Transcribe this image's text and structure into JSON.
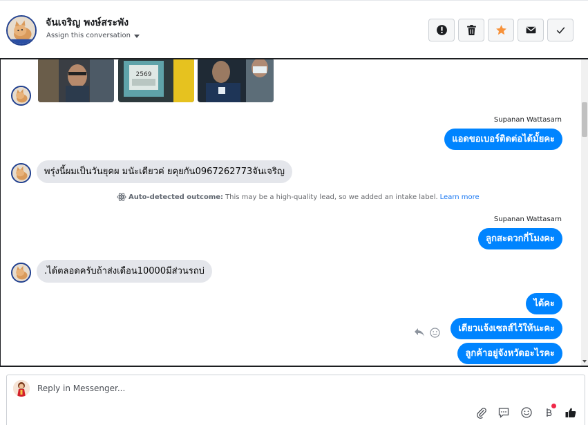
{
  "header": {
    "contact_name": "จันเจริญ พงษ์สระพัง",
    "assign_label": "Assign this conversation",
    "actions": [
      {
        "name": "mark-spam",
        "icon": "exclamation-circle-icon"
      },
      {
        "name": "delete",
        "icon": "trash-icon"
      },
      {
        "name": "star",
        "icon": "star-icon",
        "color": "#f7923b"
      },
      {
        "name": "mark-unread",
        "icon": "envelope-icon"
      },
      {
        "name": "done",
        "icon": "check-icon"
      }
    ]
  },
  "messages": [
    {
      "id": "m1",
      "direction": "in",
      "type": "photos",
      "count": 3
    },
    {
      "id": "m2",
      "direction": "out",
      "sender": "Supanan Wattasarn",
      "text": "แอดขอเบอร์ติดต่อได้มั้ยคะ"
    },
    {
      "id": "m3",
      "direction": "in",
      "text": "พรุ่งนี้ผมเป็นวันยุคผ มนัะเดียวค่ ยคุยกัน0967262773จันเจริญ"
    },
    {
      "id": "m4",
      "direction": "system",
      "icon": "atom-icon",
      "bold": "Auto-detected outcome:",
      "text": "This may be a high-quality lead, so we added an intake label.",
      "link": "Learn more"
    },
    {
      "id": "m5",
      "direction": "out",
      "sender": "Supanan Wattasarn",
      "text": "ลูกสะดวกกี่โมงคะ"
    },
    {
      "id": "m6",
      "direction": "in",
      "text": ".ได้ตลอดครับถ้าส่งเดือน10000มีส่วนรถบ่"
    },
    {
      "id": "m7",
      "direction": "out",
      "text": "ได้คะ"
    },
    {
      "id": "m8",
      "direction": "out",
      "text": "เดียวแจ้งเซลส์ไว้ให้นะคะ"
    },
    {
      "id": "m9",
      "direction": "out",
      "text": "ลูกค้าอยู่จังหวัดอะไรคะ"
    }
  ],
  "composer": {
    "placeholder": "Reply in Messenger...",
    "tools": [
      "paperclip-icon",
      "saved-reply-icon",
      "emoji-icon",
      "baht-payment-icon",
      "thumbs-up-icon"
    ]
  },
  "colors": {
    "accent": "#0084ff",
    "incoming_bubble": "#e4e6eb",
    "star": "#f7923b",
    "notification": "#f02849"
  }
}
